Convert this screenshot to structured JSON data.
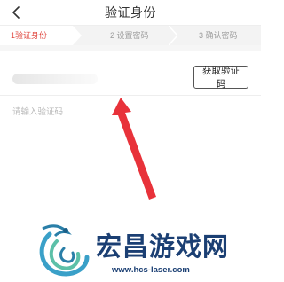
{
  "header": {
    "title": "验证身份",
    "back_icon": "back-chevron-icon"
  },
  "steps": [
    {
      "label": "1验证身份",
      "active": true
    },
    {
      "label": "2 设置密码",
      "active": false
    },
    {
      "label": "3 确认密码",
      "active": false
    }
  ],
  "form": {
    "get_code_label": "获取验证码",
    "code_placeholder": "请输入验证码"
  },
  "colors": {
    "accent": "#e0463e",
    "arrow": "#e8323a",
    "watermark": "#1b3f73"
  },
  "watermark": {
    "brand": "宏昌游戏网",
    "url": "www.hcs-laser.com"
  }
}
